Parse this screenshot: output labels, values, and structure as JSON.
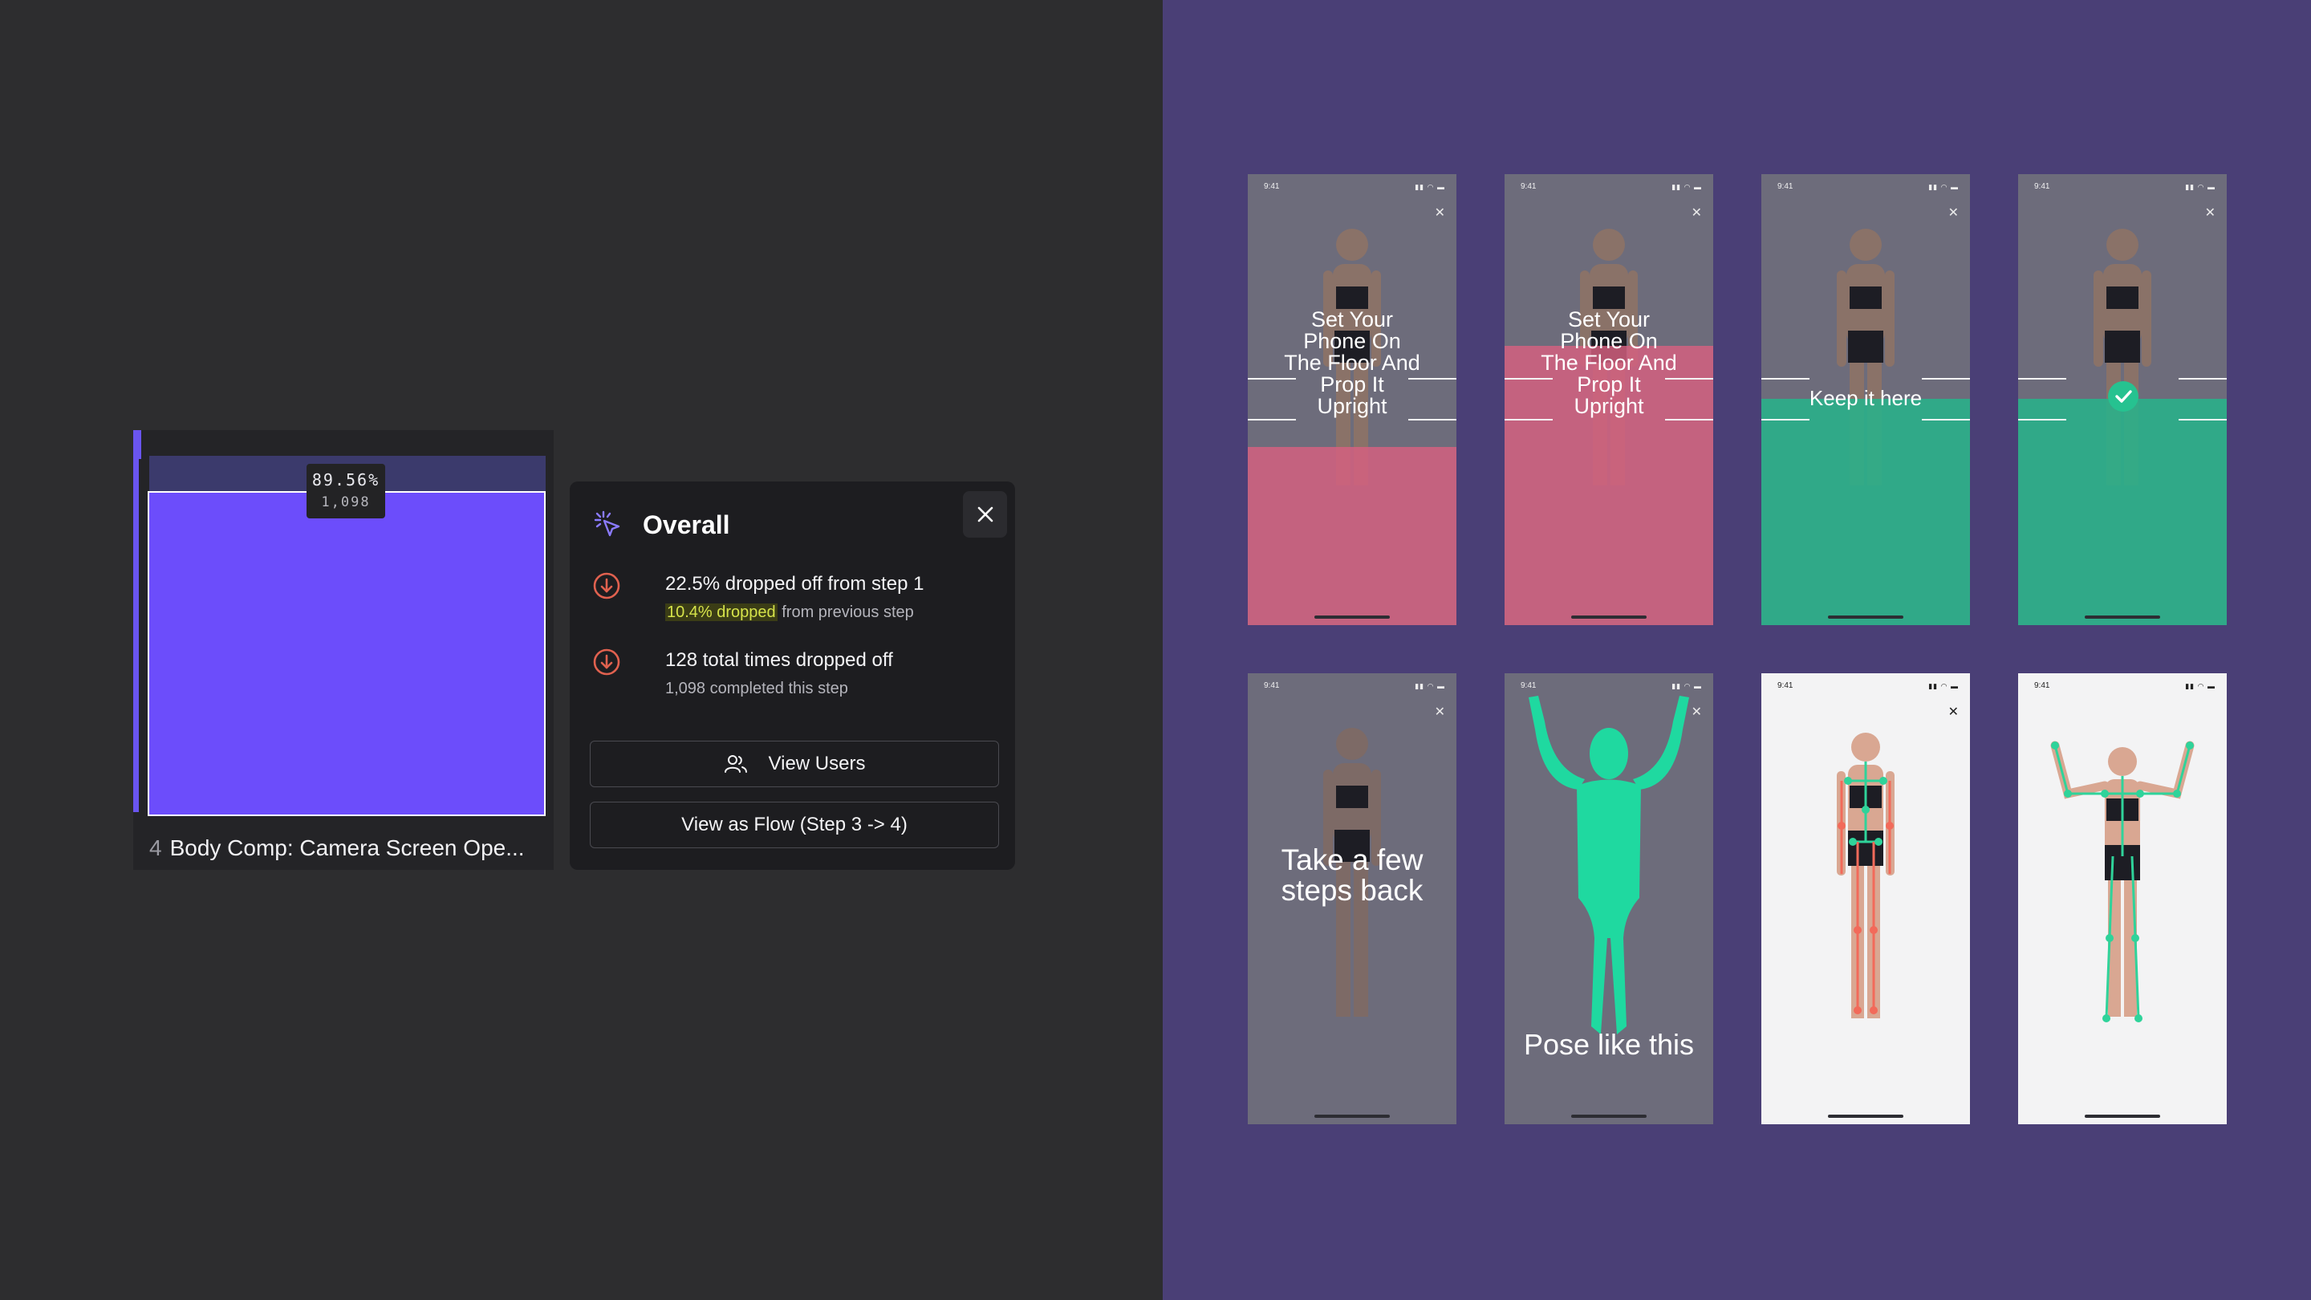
{
  "funnel": {
    "step_number": "4",
    "step_name": "Body Comp: Camera Screen Ope...",
    "tooltip_percent": "89.56%",
    "tooltip_count": "1,098",
    "bar_fill_fraction": 0.8956,
    "bar_color": "#6c4dfb"
  },
  "popover": {
    "title": "Overall",
    "stats": [
      {
        "main": "22.5% dropped off from step 1",
        "highlight": "10.4% dropped",
        "sub": " from previous step"
      },
      {
        "main": "128 total times dropped off",
        "sub": "1,098 completed this step"
      }
    ],
    "view_users_label": "View Users",
    "view_flow_label": "View as Flow (Step 3 -> 4)",
    "icons": [
      "sparkle-cursor-icon",
      "close-icon",
      "arrow-down-circle-icon",
      "users-icon"
    ],
    "accent_red": "#e0614f",
    "highlight_color": "#d6e34a"
  },
  "phones": [
    {
      "time": "9:41",
      "caption": "Set Your Phone On The Floor And Prop It Upright",
      "overlay": "red"
    },
    {
      "time": "9:41",
      "caption": "Set Your Phone On The Floor And Prop It Upright",
      "overlay": "red"
    },
    {
      "time": "9:41",
      "caption": "Keep it here",
      "overlay": "green"
    },
    {
      "time": "9:41",
      "caption": "",
      "overlay": "green",
      "icon": "check-icon"
    },
    {
      "time": "9:41",
      "caption": "Take a few steps back",
      "overlay": "none"
    },
    {
      "time": "9:41",
      "caption": "Pose like this",
      "overlay": "silhouette"
    },
    {
      "time": "9:41",
      "caption": "",
      "overlay": "skeleton"
    },
    {
      "time": "9:41",
      "caption": "",
      "overlay": "skeleton"
    }
  ],
  "colors": {
    "left_bg": "#2d2d2f",
    "right_bg": "#4a3f76",
    "red_overlay": "#d76080",
    "green_overlay": "#28b28a",
    "silhouette": "#1fd9a0"
  }
}
